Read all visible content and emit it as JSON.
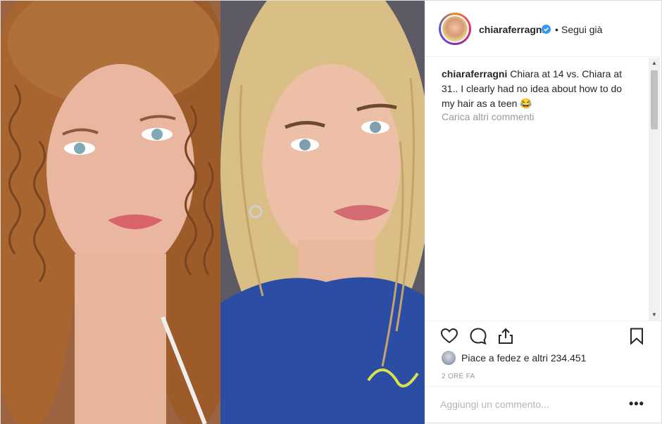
{
  "media": {
    "left_photo": "young-curly-hair-portrait",
    "right_photo": "adult-blonde-hair-portrait"
  },
  "header": {
    "username": "chiaraferragni",
    "verified_icon": "verified-badge-icon",
    "separator": "•",
    "follow_label": "Segui già"
  },
  "caption": {
    "username": "chiaraferragni",
    "text": " Chiara at 14 vs. Chiara at 31.. I clearly had no idea about how to do my hair as a teen 😂"
  },
  "comments": {
    "load_more": "Carica altri commenti"
  },
  "actions": {
    "like_icon": "heart-icon",
    "comment_icon": "comment-bubble-icon",
    "share_icon": "share-icon",
    "save_icon": "bookmark-icon"
  },
  "likes": {
    "text": "Piace a fedez e altri 234.451"
  },
  "timestamp": "2 ORE FA",
  "add_comment": {
    "placeholder": "Aggiungi un commento...",
    "options_label": "•••"
  },
  "colors": {
    "text": "#262626",
    "muted": "#999999",
    "verified": "#3897f0",
    "divider": "#efefef"
  }
}
